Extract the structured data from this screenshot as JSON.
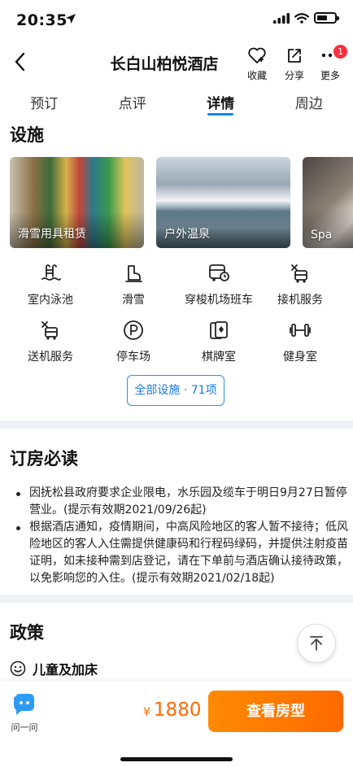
{
  "status_bar": {
    "time": "20:35"
  },
  "header": {
    "title": "长白山柏悦酒店",
    "favorite_label": "收藏",
    "share_label": "分享",
    "more_label": "更多",
    "more_badge": "1"
  },
  "tabs": [
    {
      "label": "预订"
    },
    {
      "label": "点评"
    },
    {
      "label": "详情",
      "active": true
    },
    {
      "label": "周边"
    }
  ],
  "facilities": {
    "title": "设施",
    "photos": [
      {
        "caption": "滑雪用具租赁"
      },
      {
        "caption": "户外温泉"
      },
      {
        "caption": "Spa"
      }
    ],
    "items": [
      {
        "label": "室内泳池",
        "icon": "swimming-pool-icon"
      },
      {
        "label": "滑雪",
        "icon": "ski-boot-icon"
      },
      {
        "label": "穿梭机场班车",
        "icon": "shuttle-bus-icon"
      },
      {
        "label": "接机服务",
        "icon": "airport-pickup-icon"
      },
      {
        "label": "送机服务",
        "icon": "airport-dropoff-icon"
      },
      {
        "label": "停车场",
        "icon": "parking-icon"
      },
      {
        "label": "棋牌室",
        "icon": "cards-icon"
      },
      {
        "label": "健身室",
        "icon": "dumbbell-icon"
      }
    ],
    "all_button": "全部设施 · 71项"
  },
  "booking_notice": {
    "title": "订房必读",
    "items": [
      "因抚松县政府要求企业限电，水乐园及缆车于明日9月27日暂停营业。(提示有效期2021/09/26起)",
      "根据酒店通知，疫情期间，中高风险地区的客人暂不接待；低风险地区的客人入住需提供健康码和行程码绿码，并提供注射疫苗证明，如未接种需到店登记，请在下单前与酒店确认接待政策，以免影响您的入住。(提示有效期2021/02/18起)"
    ]
  },
  "policy": {
    "title": "政策",
    "child_bed_label": "儿童及加床"
  },
  "bottom_bar": {
    "ask_label": "问一问",
    "currency": "¥",
    "price": "1880",
    "view_rooms_label": "查看房型"
  },
  "colors": {
    "accent_blue": "#0a84ff",
    "price_orange": "#ff6a00",
    "badge_red": "#ff2d3d"
  }
}
